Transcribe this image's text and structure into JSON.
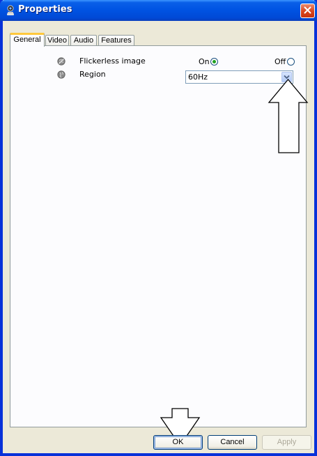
{
  "window": {
    "title": "Properties",
    "app_icon": "webcam-icon",
    "close_icon": "close-icon"
  },
  "tabs": [
    {
      "label": "General",
      "active": true
    },
    {
      "label": "Video",
      "active": false
    },
    {
      "label": "Audio",
      "active": false
    },
    {
      "label": "Features",
      "active": false
    }
  ],
  "general": {
    "flickerless": {
      "label": "Flickerless image",
      "icon": "flicker-icon",
      "on_label": "On",
      "off_label": "Off",
      "selected": "On"
    },
    "region": {
      "label": "Region",
      "icon": "region-icon",
      "value": "60Hz",
      "dropdown_icon": "chevron-down-icon"
    }
  },
  "buttons": {
    "ok": "OK",
    "cancel": "Cancel",
    "apply": "Apply"
  },
  "colors": {
    "titlebar": "#0054e3",
    "frame": "#0831d9",
    "face": "#ece9d8",
    "tab_highlight": "#ffc83c",
    "radio_dot": "#21a121",
    "close": "#d8431b"
  }
}
